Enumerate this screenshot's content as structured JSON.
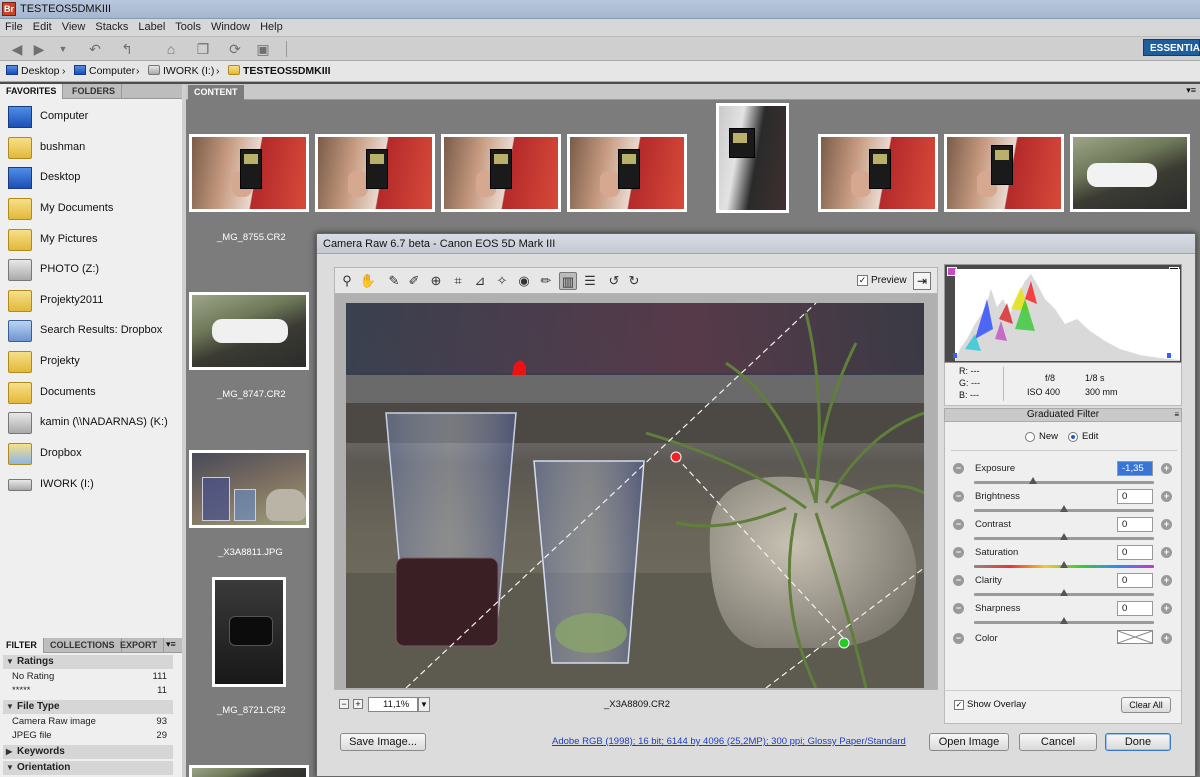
{
  "window": {
    "title": "TESTEOS5DMKIII",
    "app_icon": "Br"
  },
  "menu": [
    "File",
    "Edit",
    "View",
    "Stacks",
    "Label",
    "Tools",
    "Window",
    "Help"
  ],
  "workspace": {
    "essentials": "ESSENTIAL"
  },
  "path": {
    "crumbs": [
      "Desktop",
      "Computer",
      "IWORK (I:)",
      "TESTEOS5DMKIII"
    ]
  },
  "panel_tabs": {
    "favorites": "FAVORITES",
    "folders": "FOLDERS"
  },
  "favorites": [
    {
      "label": "Computer",
      "icon": "computer-icon"
    },
    {
      "label": "bushman",
      "icon": "folder-icon"
    },
    {
      "label": "Desktop",
      "icon": "desktop-icon"
    },
    {
      "label": "My Documents",
      "icon": "documents-folder-icon"
    },
    {
      "label": "My Pictures",
      "icon": "pictures-folder-icon"
    },
    {
      "label": "PHOTO (Z:)",
      "icon": "network-drive-icon"
    },
    {
      "label": "Projekty2011",
      "icon": "folder-icon"
    },
    {
      "label": "Search Results: Dropbox",
      "icon": "search-results-icon"
    },
    {
      "label": "Projekty",
      "icon": "folder-icon"
    },
    {
      "label": "Documents",
      "icon": "folder-icon"
    },
    {
      "label": "kamin (\\\\NADARNAS) (K:)",
      "icon": "network-drive-icon"
    },
    {
      "label": "Dropbox",
      "icon": "dropbox-folder-icon"
    },
    {
      "label": "IWORK (I:)",
      "icon": "drive-icon"
    }
  ],
  "filter_tabs": {
    "filter": "FILTER",
    "collections": "COLLECTIONS",
    "export": "EXPORT"
  },
  "filter": {
    "ratings": {
      "label": "Ratings",
      "rows": [
        {
          "label": "No Rating",
          "count": "111"
        },
        {
          "label": "*****",
          "count": "11"
        }
      ]
    },
    "file_type": {
      "label": "File Type",
      "rows": [
        {
          "label": "Camera Raw image",
          "count": "93"
        },
        {
          "label": "JPEG file",
          "count": "29"
        }
      ]
    },
    "keywords": {
      "label": "Keywords"
    },
    "orientation": {
      "label": "Orientation"
    }
  },
  "content_tab": "CONTENT",
  "thumb_labels": [
    "_MG_8755.CR2",
    "_MG_8747.CR2",
    "_X3A8811.JPG",
    "_MG_8721.CR2"
  ],
  "dialog": {
    "title": "Camera Raw 6.7 beta  -  Canon EOS 5D Mark III",
    "preview_label": "Preview",
    "zoom": "11,1%",
    "filename": "_X3A8809.CR2",
    "workflow_link": "Adobe RGB (1998); 16 bit; 6144 by 4096 (25,2MP); 300 ppi; Glossy Paper/Standard",
    "buttons": {
      "save": "Save Image...",
      "open": "Open Image",
      "cancel": "Cancel",
      "done": "Done"
    },
    "readout": {
      "r": "R:",
      "g": "G:",
      "b": "B:",
      "dash": "---",
      "aperture": "f/8",
      "shutter": "1/8 s",
      "iso": "ISO 400",
      "focal": "300 mm"
    },
    "panel_title": "Graduated Filter",
    "mode_new": "New",
    "mode_edit": "Edit",
    "sliders": [
      {
        "label": "Exposure",
        "value": "-1,35",
        "pos": 0.33
      },
      {
        "label": "Brightness",
        "value": "0",
        "pos": 0.5
      },
      {
        "label": "Contrast",
        "value": "0",
        "pos": 0.5
      },
      {
        "label": "Saturation",
        "value": "0",
        "pos": 0.5
      },
      {
        "label": "Clarity",
        "value": "0",
        "pos": 0.5
      },
      {
        "label": "Sharpness",
        "value": "0",
        "pos": 0.5
      }
    ],
    "color_label": "Color",
    "show_overlay": "Show Overlay",
    "clear_all": "Clear All"
  }
}
